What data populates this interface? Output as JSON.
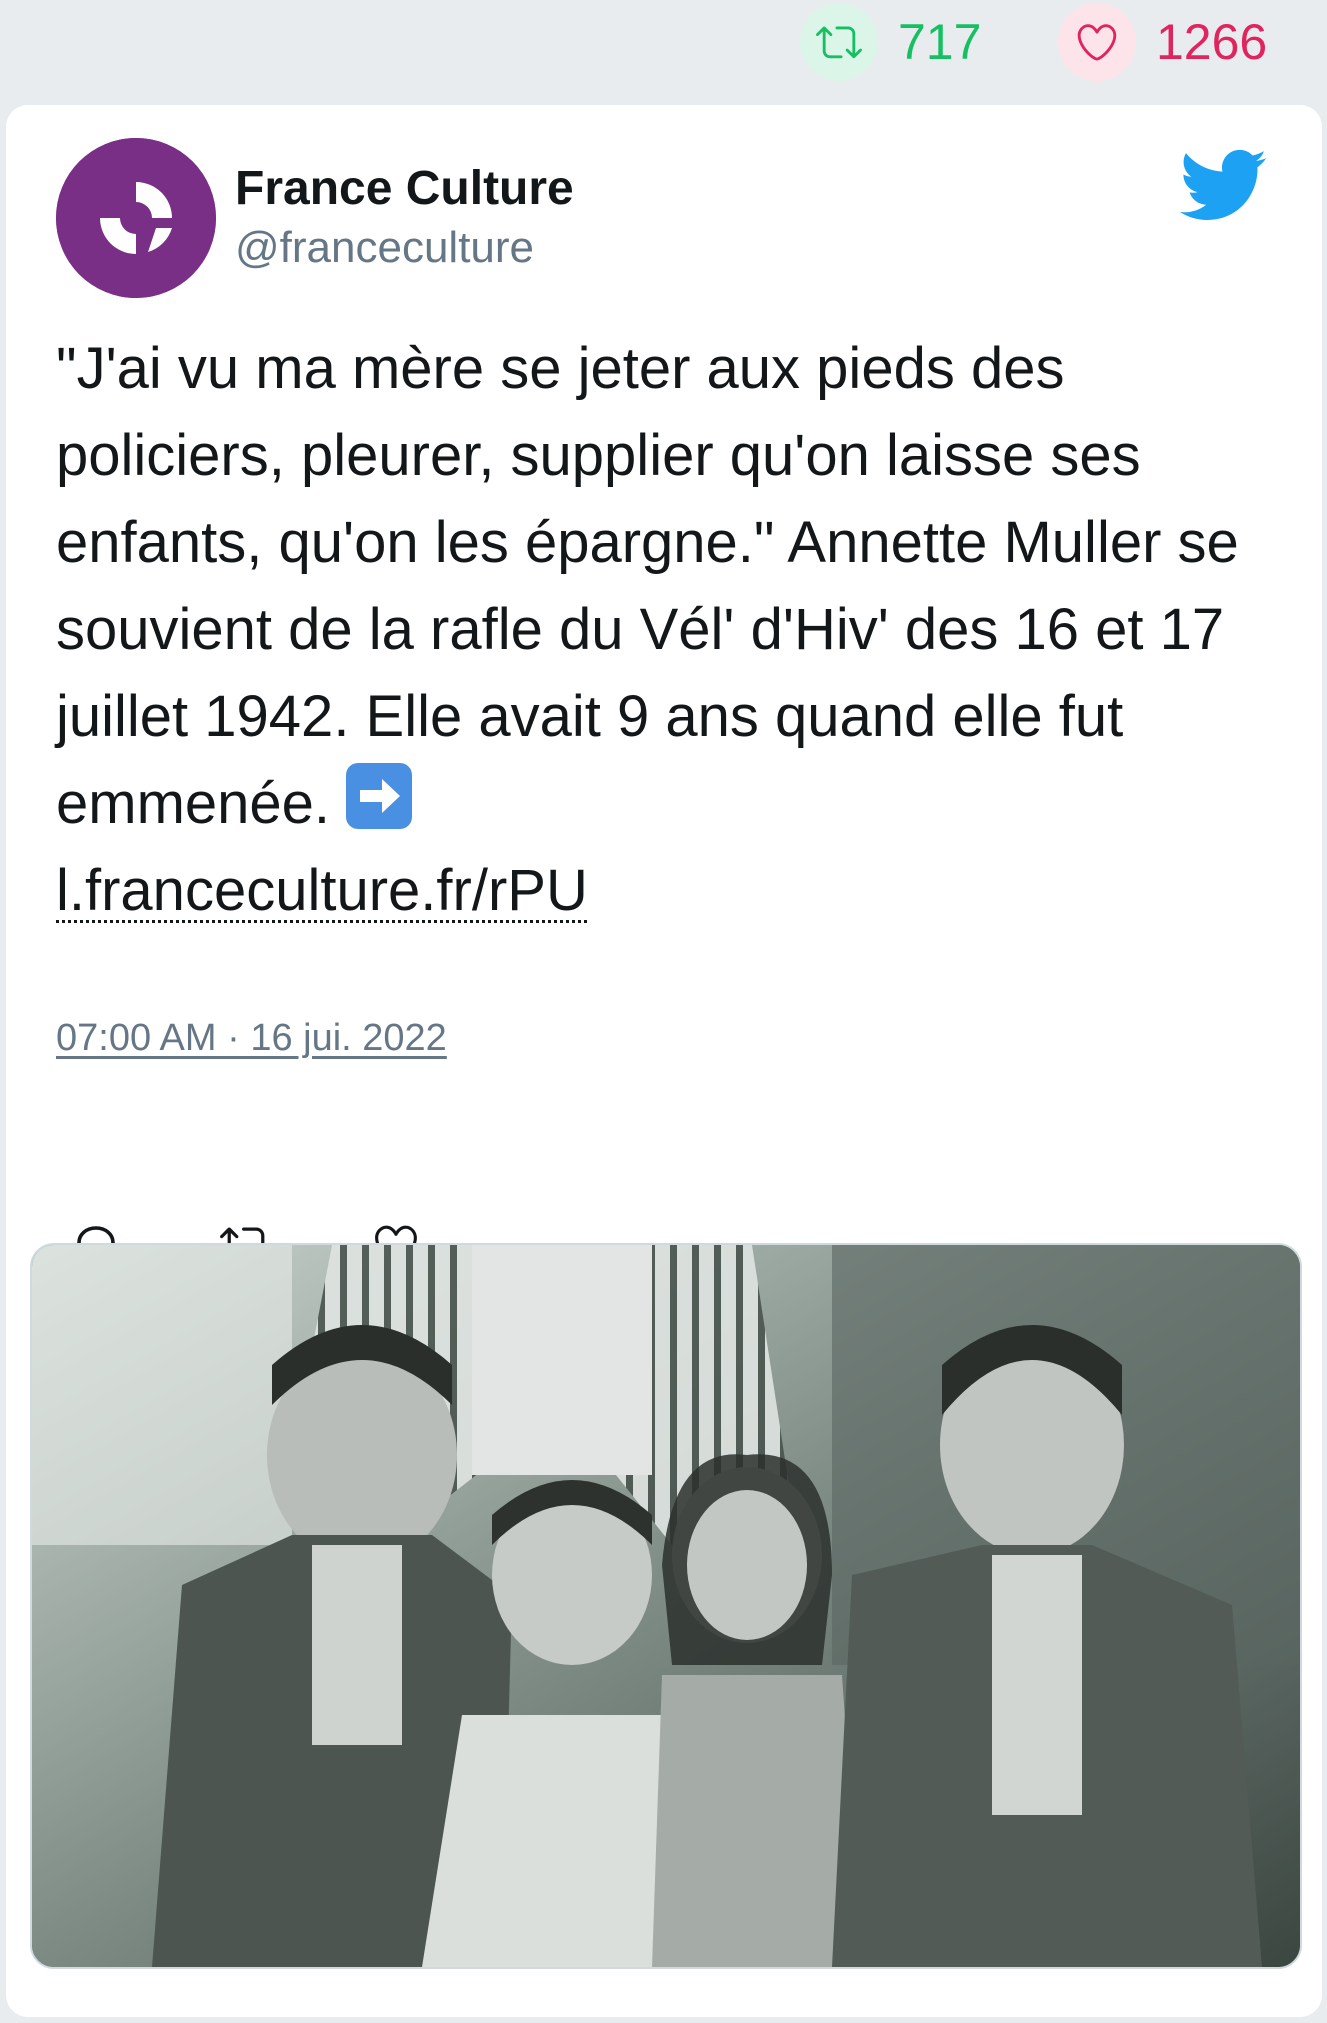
{
  "stats": {
    "retweet_count": "717",
    "like_count": "1266",
    "retweet_icon": "retweet-icon",
    "like_icon": "heart-icon",
    "retweet_color": "#17bf63",
    "like_color": "#e0245e"
  },
  "tweet": {
    "author_name": "France Culture",
    "author_handle": "@franceculture",
    "text": "\"J'ai vu ma mère se jeter aux pieds des policiers, pleurer, supplier qu'on laisse ses enfants, qu'on les épargne.\" Annette Muller se souvient de la rafle du Vél' d'Hiv' des 16 et 17 juillet 1942. Elle avait 9 ans quand elle fut emmenée.",
    "link": "l.franceculture.fr/rPU",
    "timestamp": "07:00 AM · 16 jui. 2022",
    "brand_color": "#7a2f87",
    "twitter_color": "#1da1f2"
  },
  "actions": [
    "reply-icon",
    "retweet-icon",
    "heart-icon"
  ],
  "media": {
    "description_icon": "photo-image"
  }
}
